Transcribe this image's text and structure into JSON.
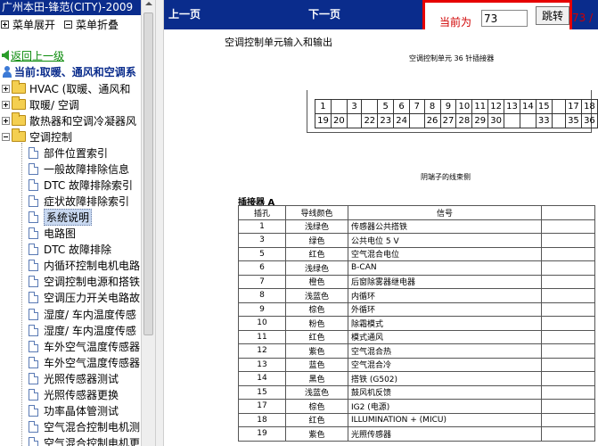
{
  "sidebar": {
    "title": "广州本田-锋范(CITY)-2009",
    "expand_all": "菜单展开",
    "collapse_all": "菜单折叠",
    "back_link": "返回上一级",
    "current": "当前:取暖、通风和空调系",
    "folders": [
      "HVAC (取暖、通风和",
      "取暖/ 空调",
      "散热器和空调冷凝器风",
      "空调控制"
    ],
    "items": [
      "部件位置索引",
      "一般故障排除信息",
      "DTC 故障排除索引",
      "症状故障排除索引",
      "系统说明",
      "电路图",
      "DTC 故障排除",
      "内循环控制电机电路",
      "空调控制电源和搭铁",
      "空调压力开关电路故",
      "湿度/ 车内温度传感",
      "湿度/ 车内温度传感",
      "车外空气温度传感器",
      "车外空气温度传感器",
      "光照传感器测试",
      "光照传感器更换",
      "功率晶体管测试",
      "空气混合控制电机测",
      "空气混合控制电机更"
    ],
    "selected_index": 4
  },
  "viewer": {
    "prev_page": "上一页",
    "next_page": "下一页",
    "current_label": "当前为",
    "page_value": "73",
    "jump_button": "跳转",
    "total": "73 /"
  },
  "document": {
    "title": "空调控制单元输入和输出",
    "connector_title": "空调控制单元 36 针插接器",
    "pin_row1": [
      "1",
      "",
      "3",
      "",
      "5",
      "6",
      "7",
      "8",
      "9",
      "10",
      "11",
      "12",
      "13",
      "14",
      "15",
      "",
      "17",
      "18"
    ],
    "pin_row2": [
      "19",
      "20",
      "",
      "22",
      "23",
      "24",
      "",
      "26",
      "27",
      "28",
      "29",
      "30",
      "",
      "",
      "33",
      "",
      "35",
      "36"
    ],
    "caption": "阴端子的线束侧",
    "connector_label": "插接器 A",
    "headers": [
      "插孔",
      "导线颜色",
      "信号",
      ""
    ],
    "rows": [
      [
        "1",
        "浅绿色",
        "传感器公共搭铁"
      ],
      [
        "3",
        "绿色",
        "公共电位 5 V"
      ],
      [
        "5",
        "红色",
        "空气混合电位"
      ],
      [
        "6",
        "浅绿色",
        "B-CAN"
      ],
      [
        "7",
        "橙色",
        "后窗除雾器继电器"
      ],
      [
        "8",
        "浅蓝色",
        "内循环"
      ],
      [
        "9",
        "棕色",
        "外循环"
      ],
      [
        "10",
        "粉色",
        "除霜模式"
      ],
      [
        "11",
        "红色",
        "模式通风"
      ],
      [
        "12",
        "紫色",
        "空气混合热"
      ],
      [
        "13",
        "蓝色",
        "空气混合冷"
      ],
      [
        "14",
        "黑色",
        "搭铁 (G502)"
      ],
      [
        "15",
        "浅蓝色",
        "鼓风机反馈"
      ],
      [
        "17",
        "棕色",
        "IG2 (电源)"
      ],
      [
        "18",
        "红色",
        "ILLUMINATION + (MICU)"
      ],
      [
        "19",
        "紫色",
        "光照传感器"
      ]
    ]
  }
}
